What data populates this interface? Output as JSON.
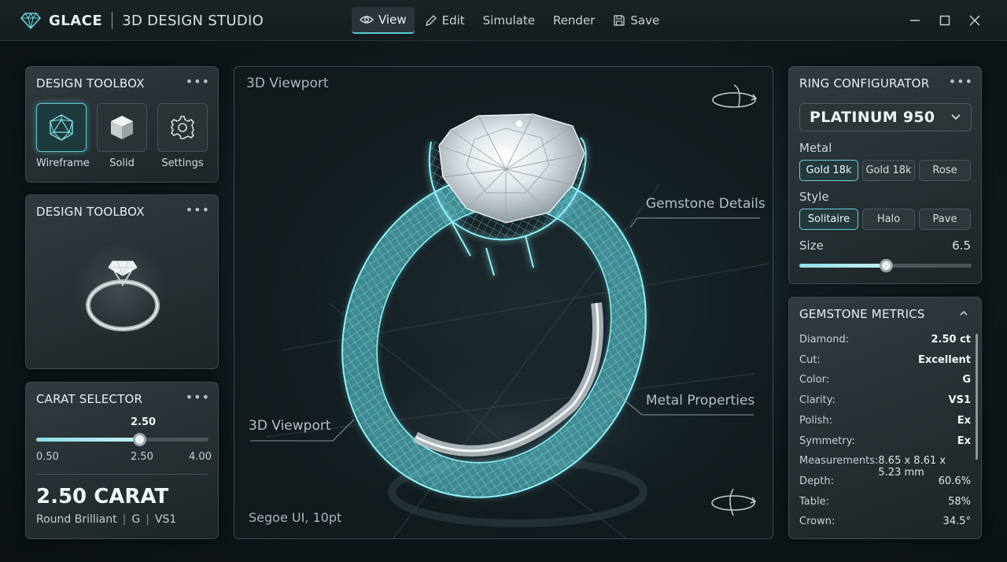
{
  "app": {
    "name": "GLACE",
    "subtitle": "3D DESIGN STUDIO"
  },
  "menu": [
    {
      "label": "View",
      "icon": "eye-icon",
      "active": true
    },
    {
      "label": "Edit",
      "icon": "pencil-icon",
      "active": false
    },
    {
      "label": "Simulate",
      "icon": "",
      "active": false
    },
    {
      "label": "Render",
      "icon": "",
      "active": false
    },
    {
      "label": "Save",
      "icon": "save-icon",
      "active": false
    }
  ],
  "toolbox": {
    "title": "DESIGN TOOLBOX",
    "tools": [
      {
        "label": "Wireframe",
        "icon": "icosahedron-icon",
        "active": true
      },
      {
        "label": "Solid",
        "icon": "cube-icon",
        "active": false
      },
      {
        "label": "Settings",
        "icon": "gear-icon",
        "active": false
      }
    ]
  },
  "preview": {
    "title": "DESIGN TOOLBOX"
  },
  "carat": {
    "title": "CARAT SELECTOR",
    "current": "2.50",
    "min": "0.50",
    "mid": "2.50",
    "max": "4.00",
    "fraction": 0.6,
    "big_label": "2.50 CARAT",
    "cut": "Round Brilliant",
    "color": "G",
    "clarity": "VS1"
  },
  "viewport": {
    "title": "3D Viewport",
    "label_gemstone": "Gemstone Details",
    "label_metal": "Metal Properties",
    "label_viewport": "3D Viewport",
    "footer": "Segoe UI, 10pt"
  },
  "configurator": {
    "title": "RING CONFIGURATOR",
    "material": "PLATINUM 950",
    "metal_label": "Metal",
    "metal_options": [
      "Gold 18k",
      "Gold 18k",
      "Rose"
    ],
    "style_label": "Style",
    "style_options": [
      "Solitaire",
      "Halo",
      "Pave"
    ],
    "size_label": "Size",
    "size_value": "6.5",
    "size_fraction": 0.5
  },
  "metrics": {
    "title": "GEMSTONE METRICS",
    "rows": [
      {
        "key": "Diamond:",
        "value": "2.50 ct"
      },
      {
        "key": "Cut:",
        "value": "Excellent"
      },
      {
        "key": "Color:",
        "value": "G"
      },
      {
        "key": "Clarity:",
        "value": "VS1"
      },
      {
        "key": "Polish:",
        "value": "Ex"
      },
      {
        "key": "Symmetry:",
        "value": "Ex"
      },
      {
        "key": "Measurements:",
        "value": "8.65 x 8.61 x 5.23 mm"
      },
      {
        "key": "Depth:",
        "value": "60.6%"
      },
      {
        "key": "Table:",
        "value": "58%"
      },
      {
        "key": "Crown:",
        "value": "34.5°"
      }
    ]
  },
  "colors": {
    "accent": "#5cc9d1",
    "wireframe": "#6fe3ec",
    "panel": "#2c3639"
  }
}
